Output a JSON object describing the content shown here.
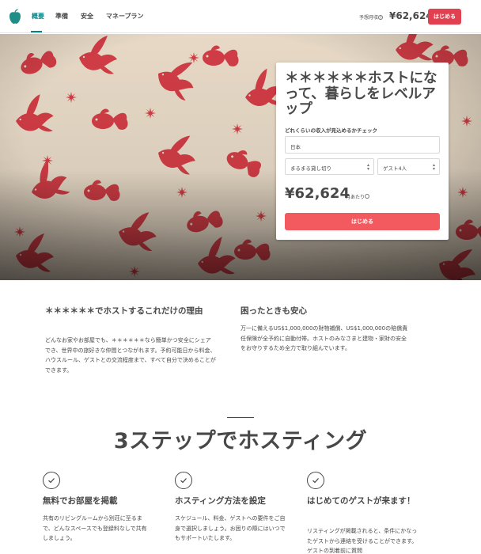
{
  "header": {
    "logo": "apple-logo-icon",
    "nav": [
      "概要",
      "準備",
      "安全",
      "マネープラン"
    ],
    "estimate_label": "予想月収",
    "estimate_amount": "¥62,624",
    "start_button": "はじめる"
  },
  "hero_card": {
    "title": "＊＊＊＊＊＊ホストになって、暮らしをレベルアップ",
    "subtitle": "どれくらいの収入が見込めるかチェック",
    "country": "日本",
    "place_type": "まるまる貸し切り",
    "guests": "ゲスト4人",
    "amount": "¥62,624",
    "per_month": "月あたり",
    "start_button": "はじめる"
  },
  "info": [
    {
      "title": "＊＊＊＊＊＊でホストするこれだけの理由",
      "body": "どんなお家やお部屋でも、＊＊＊＊＊＊なら簡単かつ安全にシェアでき、世界中の旅好きな仲間とつながれます。予約可能日から料金、ハウスルール、ゲストとの交流程度まで、すべて自分で決めることができます。"
    },
    {
      "title": "困ったときも安心",
      "body": "万一に備えるUS$1,000,000の財物補償、US$1,000,000の賠償責任保険が全予約に自動付帯。ホストのみなさまと建物・家財の安全をお守りするため全力で取り組んでいます。"
    }
  ],
  "steps": {
    "heading": "3ステップでホスティング",
    "items": [
      {
        "title": "無料でお部屋を掲載",
        "body": "共有のリビングルームから別荘に至るまで、どんなスペースでも登録料なしで共有しましょう。"
      },
      {
        "title": "ホスティング方法を設定",
        "body": "スケジュール、料金、ゲストへの要件をご自身で選択しましょう。お困りの際にはいつでもサポートいたします。"
      },
      {
        "title": "はじめてのゲストが来ます！",
        "body": "リスティングが掲載されると、条件にかなったゲストから連絡を受けることができます。ゲストの到着前に質問"
      }
    ]
  },
  "colors": {
    "accent_teal": "#008489",
    "brand_red": "#e0404f",
    "button_coral": "#f35a5f",
    "pattern_red": "#cf2f3a"
  }
}
